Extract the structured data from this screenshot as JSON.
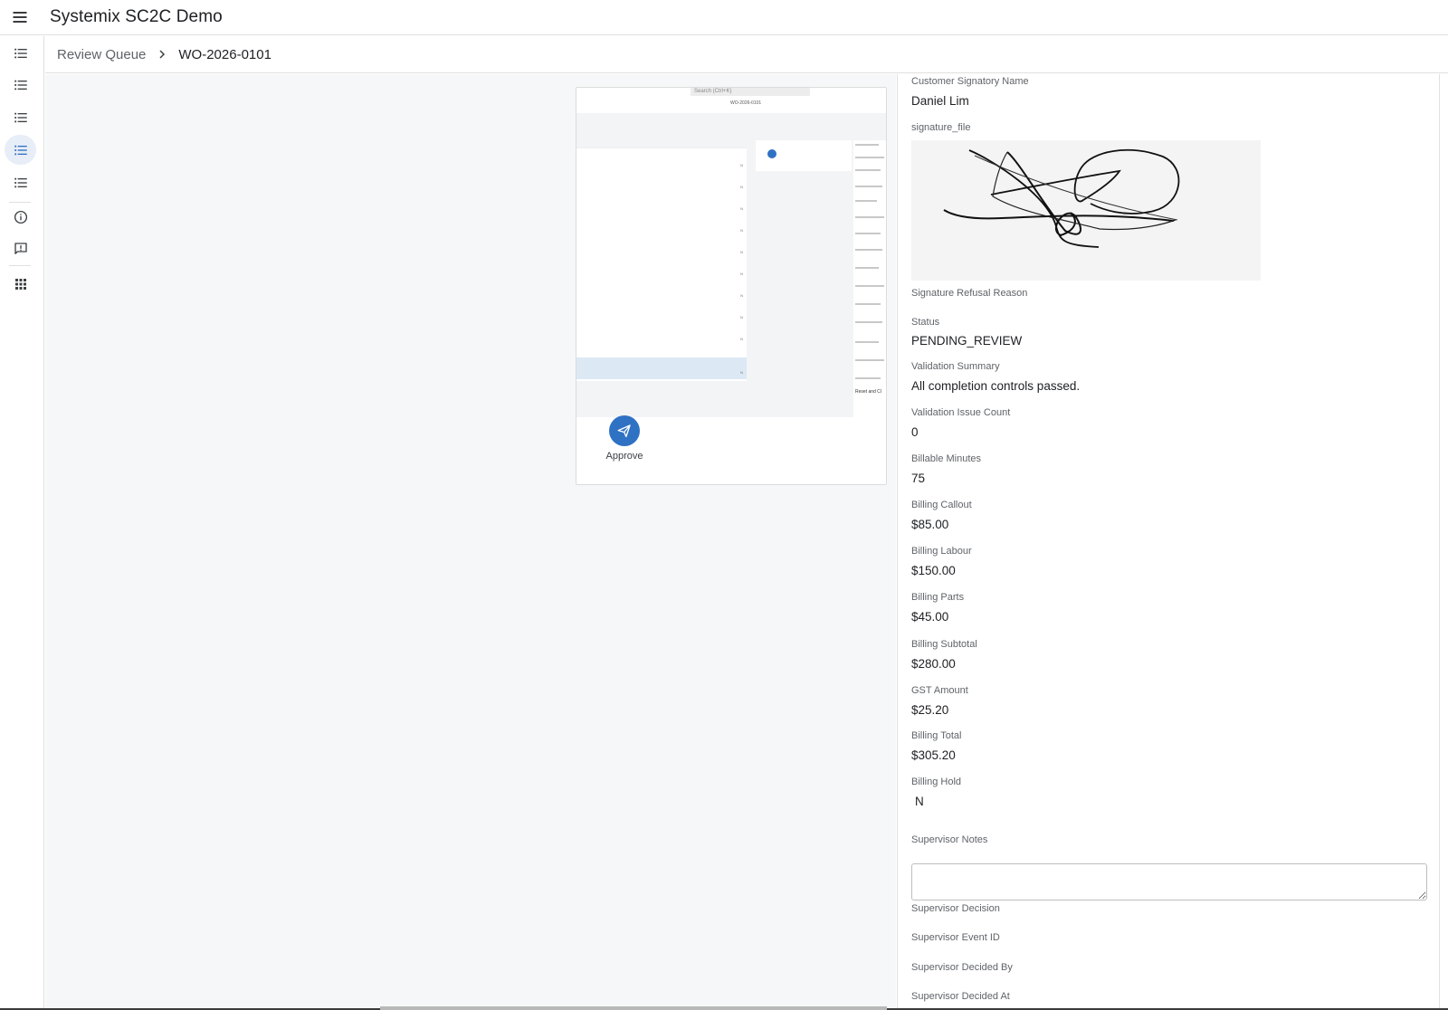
{
  "app": {
    "title": "Systemix SC2C Demo"
  },
  "icons": {
    "menu": "menu-icon",
    "rail": [
      "list-icon",
      "list-icon",
      "list-icon",
      "list-icon",
      "list-icon",
      "info-icon",
      "feedback-icon",
      "apps-grid-icon"
    ],
    "breadcrumb_separator": "chevron-right-icon",
    "approve": "send-icon"
  },
  "breadcrumb": {
    "parent": "Review Queue",
    "current": "WO-2026-0101"
  },
  "preview": {
    "search_text": "Search (Ctrl+K)",
    "crumb_text": "WO-2026-0101",
    "side_button_text": "Reset and Cl"
  },
  "actions": {
    "approve_label": "Approve"
  },
  "details": {
    "customer_signatory_name": {
      "label": "Customer Signatory Name",
      "value": "Daniel Lim"
    },
    "signature_file": {
      "label": "signature_file"
    },
    "signature_refusal_reason": {
      "label": "Signature Refusal Reason",
      "value": ""
    },
    "status": {
      "label": "Status",
      "value": "PENDING_REVIEW"
    },
    "validation_summary": {
      "label": "Validation Summary",
      "value": "All completion controls passed."
    },
    "validation_issue_count": {
      "label": "Validation Issue Count",
      "value": "0"
    },
    "billable_minutes": {
      "label": "Billable Minutes",
      "value": "75"
    },
    "billing_callout": {
      "label": "Billing Callout",
      "value": "$85.00"
    },
    "billing_labour": {
      "label": "Billing Labour",
      "value": "$150.00"
    },
    "billing_parts": {
      "label": "Billing Parts",
      "value": "$45.00"
    },
    "billing_subtotal": {
      "label": "Billing Subtotal",
      "value": "$280.00"
    },
    "gst_amount": {
      "label": "GST Amount",
      "value": "$25.20"
    },
    "billing_total": {
      "label": "Billing Total",
      "value": "$305.20"
    },
    "billing_hold": {
      "label": "Billing Hold",
      "value": "N"
    },
    "supervisor_notes": {
      "label": "Supervisor Notes",
      "value": "",
      "placeholder": ""
    },
    "supervisor_decision": {
      "label": "Supervisor Decision",
      "value": ""
    },
    "supervisor_event_id": {
      "label": "Supervisor Event ID",
      "value": ""
    },
    "supervisor_decided_by": {
      "label": "Supervisor Decided By",
      "value": ""
    },
    "supervisor_decided_at": {
      "label": "Supervisor Decided At",
      "value": ""
    }
  },
  "colors": {
    "accent": "#2f72c4",
    "rail_active_bg": "#e8eef7",
    "main_bg": "#f6f7f9"
  }
}
